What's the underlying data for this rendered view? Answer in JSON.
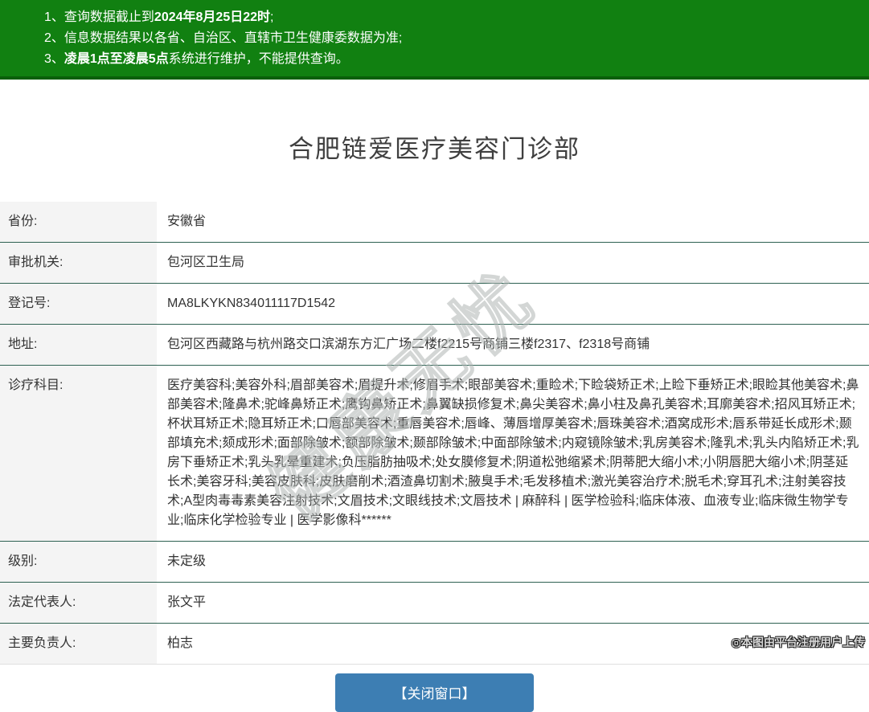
{
  "notice": {
    "items": [
      {
        "num": "1、",
        "pre": "查询数据截止到",
        "bold": "2024年8月25日22时",
        "post": ";"
      },
      {
        "num": "2、",
        "pre": "信息数据结果以各省、自治区、直辖市卫生健康委数据为准;",
        "bold": "",
        "post": ""
      },
      {
        "num": "3、",
        "pre": "",
        "bold": "凌晨1点至凌晨5点",
        "post": "系统进行维护，不能提供查询。"
      }
    ]
  },
  "page": {
    "title": "合肥链爱医疗美容门诊部"
  },
  "table": {
    "rows": [
      {
        "label": "省份:",
        "value": "安徽省"
      },
      {
        "label": "审批机关:",
        "value": "包河区卫生局"
      },
      {
        "label": "登记号:",
        "value": "MA8LKYKN834011117D1542"
      },
      {
        "label": "地址:",
        "value": "包河区西藏路与杭州路交口滨湖东方汇广场二楼f2215号商铺三楼f2317、f2318号商铺"
      },
      {
        "label": "诊疗科目:",
        "value": "医疗美容科;美容外科;眉部美容术;眉提升术;修眉手术;眼部美容术;重睑术;下睑袋矫正术;上睑下垂矫正术;眼睑其他美容术;鼻部美容术;隆鼻术;驼峰鼻矫正术;鹰钩鼻矫正术;鼻翼缺损修复术;鼻尖美容术;鼻小柱及鼻孔美容术;耳廓美容术;招风耳矫正术;杯状耳矫正术;隐耳矫正术;口唇部美容术;重唇美容术;唇峰、薄唇增厚美容术;唇珠美容术;酒窝成形术;唇系带延长成形术;颞部填充术;颏成形术;面部除皱术;额部除皱术;颞部除皱术;中面部除皱术;内窥镜除皱术;乳房美容术;隆乳术;乳头内陷矫正术;乳房下垂矫正术;乳头乳晕重建术;负压脂肪抽吸术;处女膜修复术;阴道松弛缩紧术;阴蒂肥大缩小术;小阴唇肥大缩小术;阴茎延长术;美容牙科;美容皮肤科;皮肤磨削术;酒渣鼻切割术;腋臭手术;毛发移植术;激光美容治疗术;脱毛术;穿耳孔术;注射美容技术;A型肉毒毒素美容注射技术;文眉技术;文眼线技术;文唇技术 | 麻醉科 | 医学检验科;临床体液、血液专业;临床微生物学专业;临床化学检验专业 | 医学影像科******"
      },
      {
        "label": "级别:",
        "value": "未定级"
      },
      {
        "label": "法定代表人:",
        "value": "张文平"
      },
      {
        "label": "主要负责人:",
        "value": "柏志"
      }
    ]
  },
  "button": {
    "close_label": "【关闭窗口】"
  },
  "watermark": {
    "text": "健康无忧"
  },
  "footer": {
    "credit": "◎本图由平台注册用户上传"
  },
  "colors": {
    "header_green": "#118011",
    "header_green_dark": "#0a5f0a",
    "divider_green": "#2e6152",
    "label_bg": "#f4f4f4",
    "button_blue": "#3d7eb3",
    "text": "#333333"
  }
}
